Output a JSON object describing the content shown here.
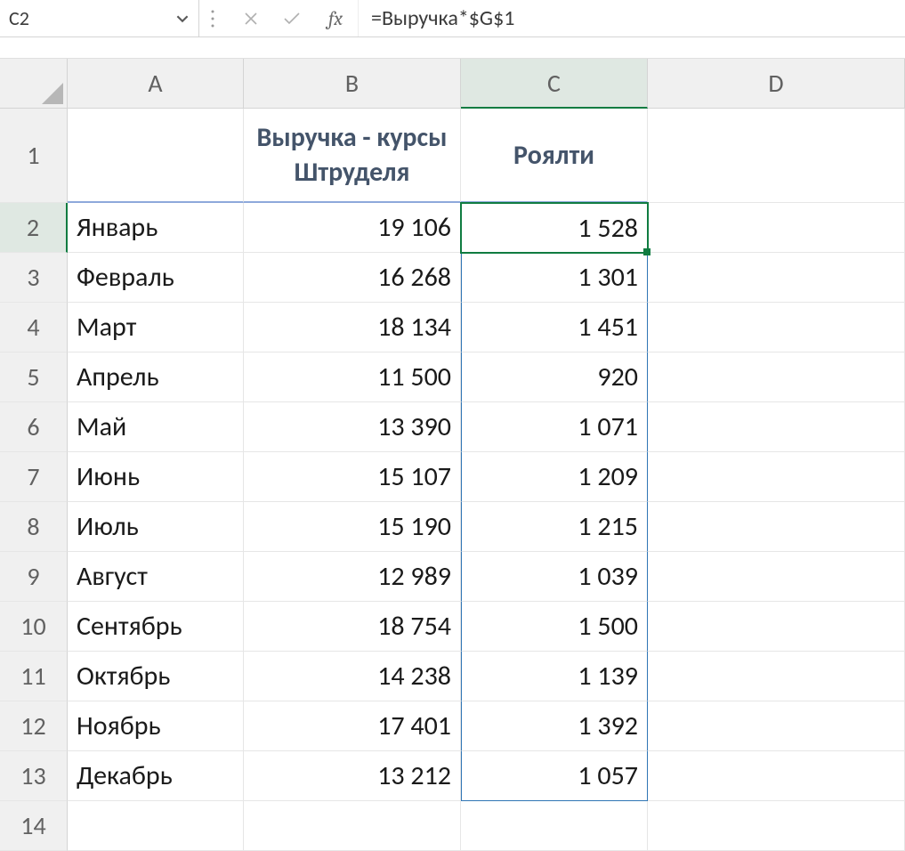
{
  "name_box": "C2",
  "formula": "=Выручка*$G$1",
  "fx_label": "fx",
  "columns": [
    "A",
    "B",
    "C",
    "D"
  ],
  "selected_column": "C",
  "headers": {
    "A": "",
    "B": "Выручка - курсы Штруделя",
    "C": "Роялти"
  },
  "rows": [
    {
      "n": "1"
    },
    {
      "n": "2",
      "month": "Январь",
      "rev": "19 106",
      "roy": "1 528"
    },
    {
      "n": "3",
      "month": "Февраль",
      "rev": "16 268",
      "roy": "1 301"
    },
    {
      "n": "4",
      "month": "Март",
      "rev": "18 134",
      "roy": "1 451"
    },
    {
      "n": "5",
      "month": "Апрель",
      "rev": "11 500",
      "roy": "920"
    },
    {
      "n": "6",
      "month": "Май",
      "rev": "13 390",
      "roy": "1 071"
    },
    {
      "n": "7",
      "month": "Июнь",
      "rev": "15 107",
      "roy": "1 209"
    },
    {
      "n": "8",
      "month": "Июль",
      "rev": "15 190",
      "roy": "1 215"
    },
    {
      "n": "9",
      "month": "Август",
      "rev": "12 989",
      "roy": "1 039"
    },
    {
      "n": "10",
      "month": "Сентябрь",
      "rev": "18 754",
      "roy": "1 500"
    },
    {
      "n": "11",
      "month": "Октябрь",
      "rev": "14 238",
      "roy": "1 139"
    },
    {
      "n": "12",
      "month": "Ноябрь",
      "rev": "17 401",
      "roy": "1 392"
    },
    {
      "n": "13",
      "month": "Декабрь",
      "rev": "13 212",
      "roy": "1 057"
    },
    {
      "n": "14"
    }
  ],
  "active_cell": "C2"
}
